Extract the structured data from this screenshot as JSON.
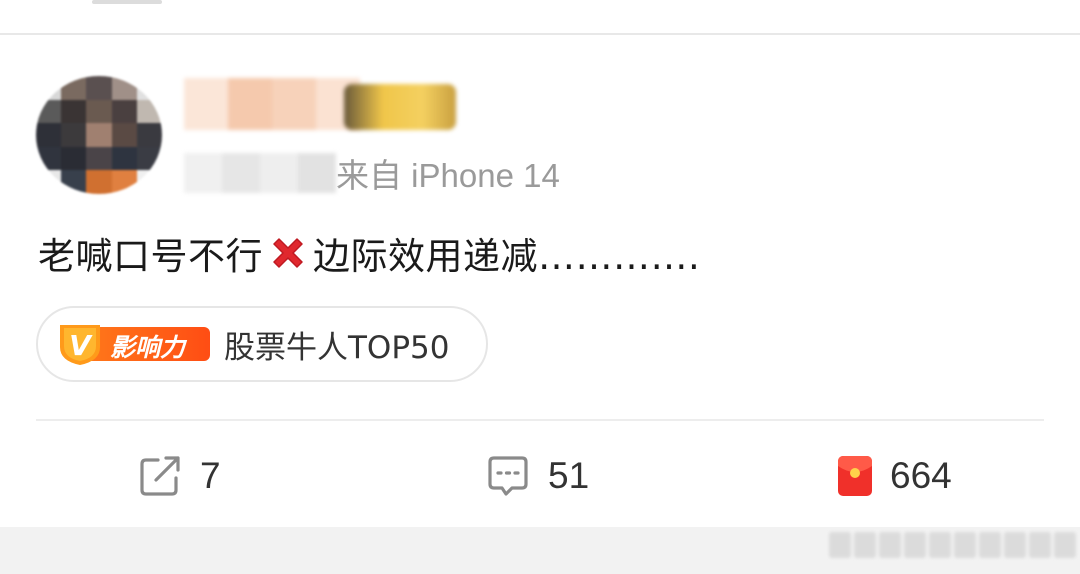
{
  "post": {
    "source": "来自 iPhone 14",
    "text_before": "老喊口号不行",
    "text_after": "边际效用递减………….",
    "cross_icon": "cross-mark-icon"
  },
  "tag": {
    "badge_label": "影响力",
    "badge_letter": "V",
    "text": "股票牛人TOP50"
  },
  "actions": {
    "repost_count": "7",
    "comment_count": "51",
    "like_count": "664"
  },
  "colors": {
    "accent_orange": "#ff5a14",
    "red_envelope": "#f0302a",
    "text_primary": "#1a1a1a",
    "text_secondary": "#9a9a9a",
    "icon_gray": "#8a8a8a"
  }
}
